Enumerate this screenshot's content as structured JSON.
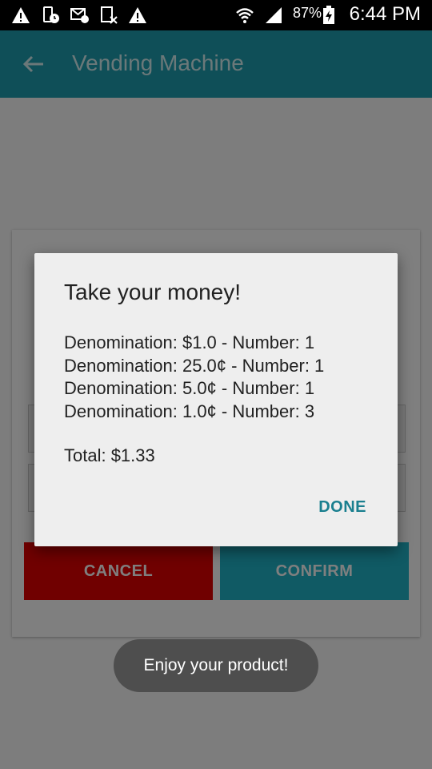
{
  "status_bar": {
    "battery": "87%",
    "time": "6:44 PM"
  },
  "app_bar": {
    "title": "Vending Machine"
  },
  "form": {
    "cancel_label": "CANCEL",
    "confirm_label": "CONFIRM"
  },
  "dialog": {
    "title": "Take your money!",
    "lines": [
      "Denomination: $1.0 - Number: 1",
      "Denomination: 25.0¢ - Number: 1",
      "Denomination: 5.0¢ - Number: 1",
      "Denomination: 1.0¢ - Number: 3"
    ],
    "total": "Total: $1.33",
    "done_label": "DONE"
  },
  "toast": {
    "message": "Enjoy your product!"
  }
}
